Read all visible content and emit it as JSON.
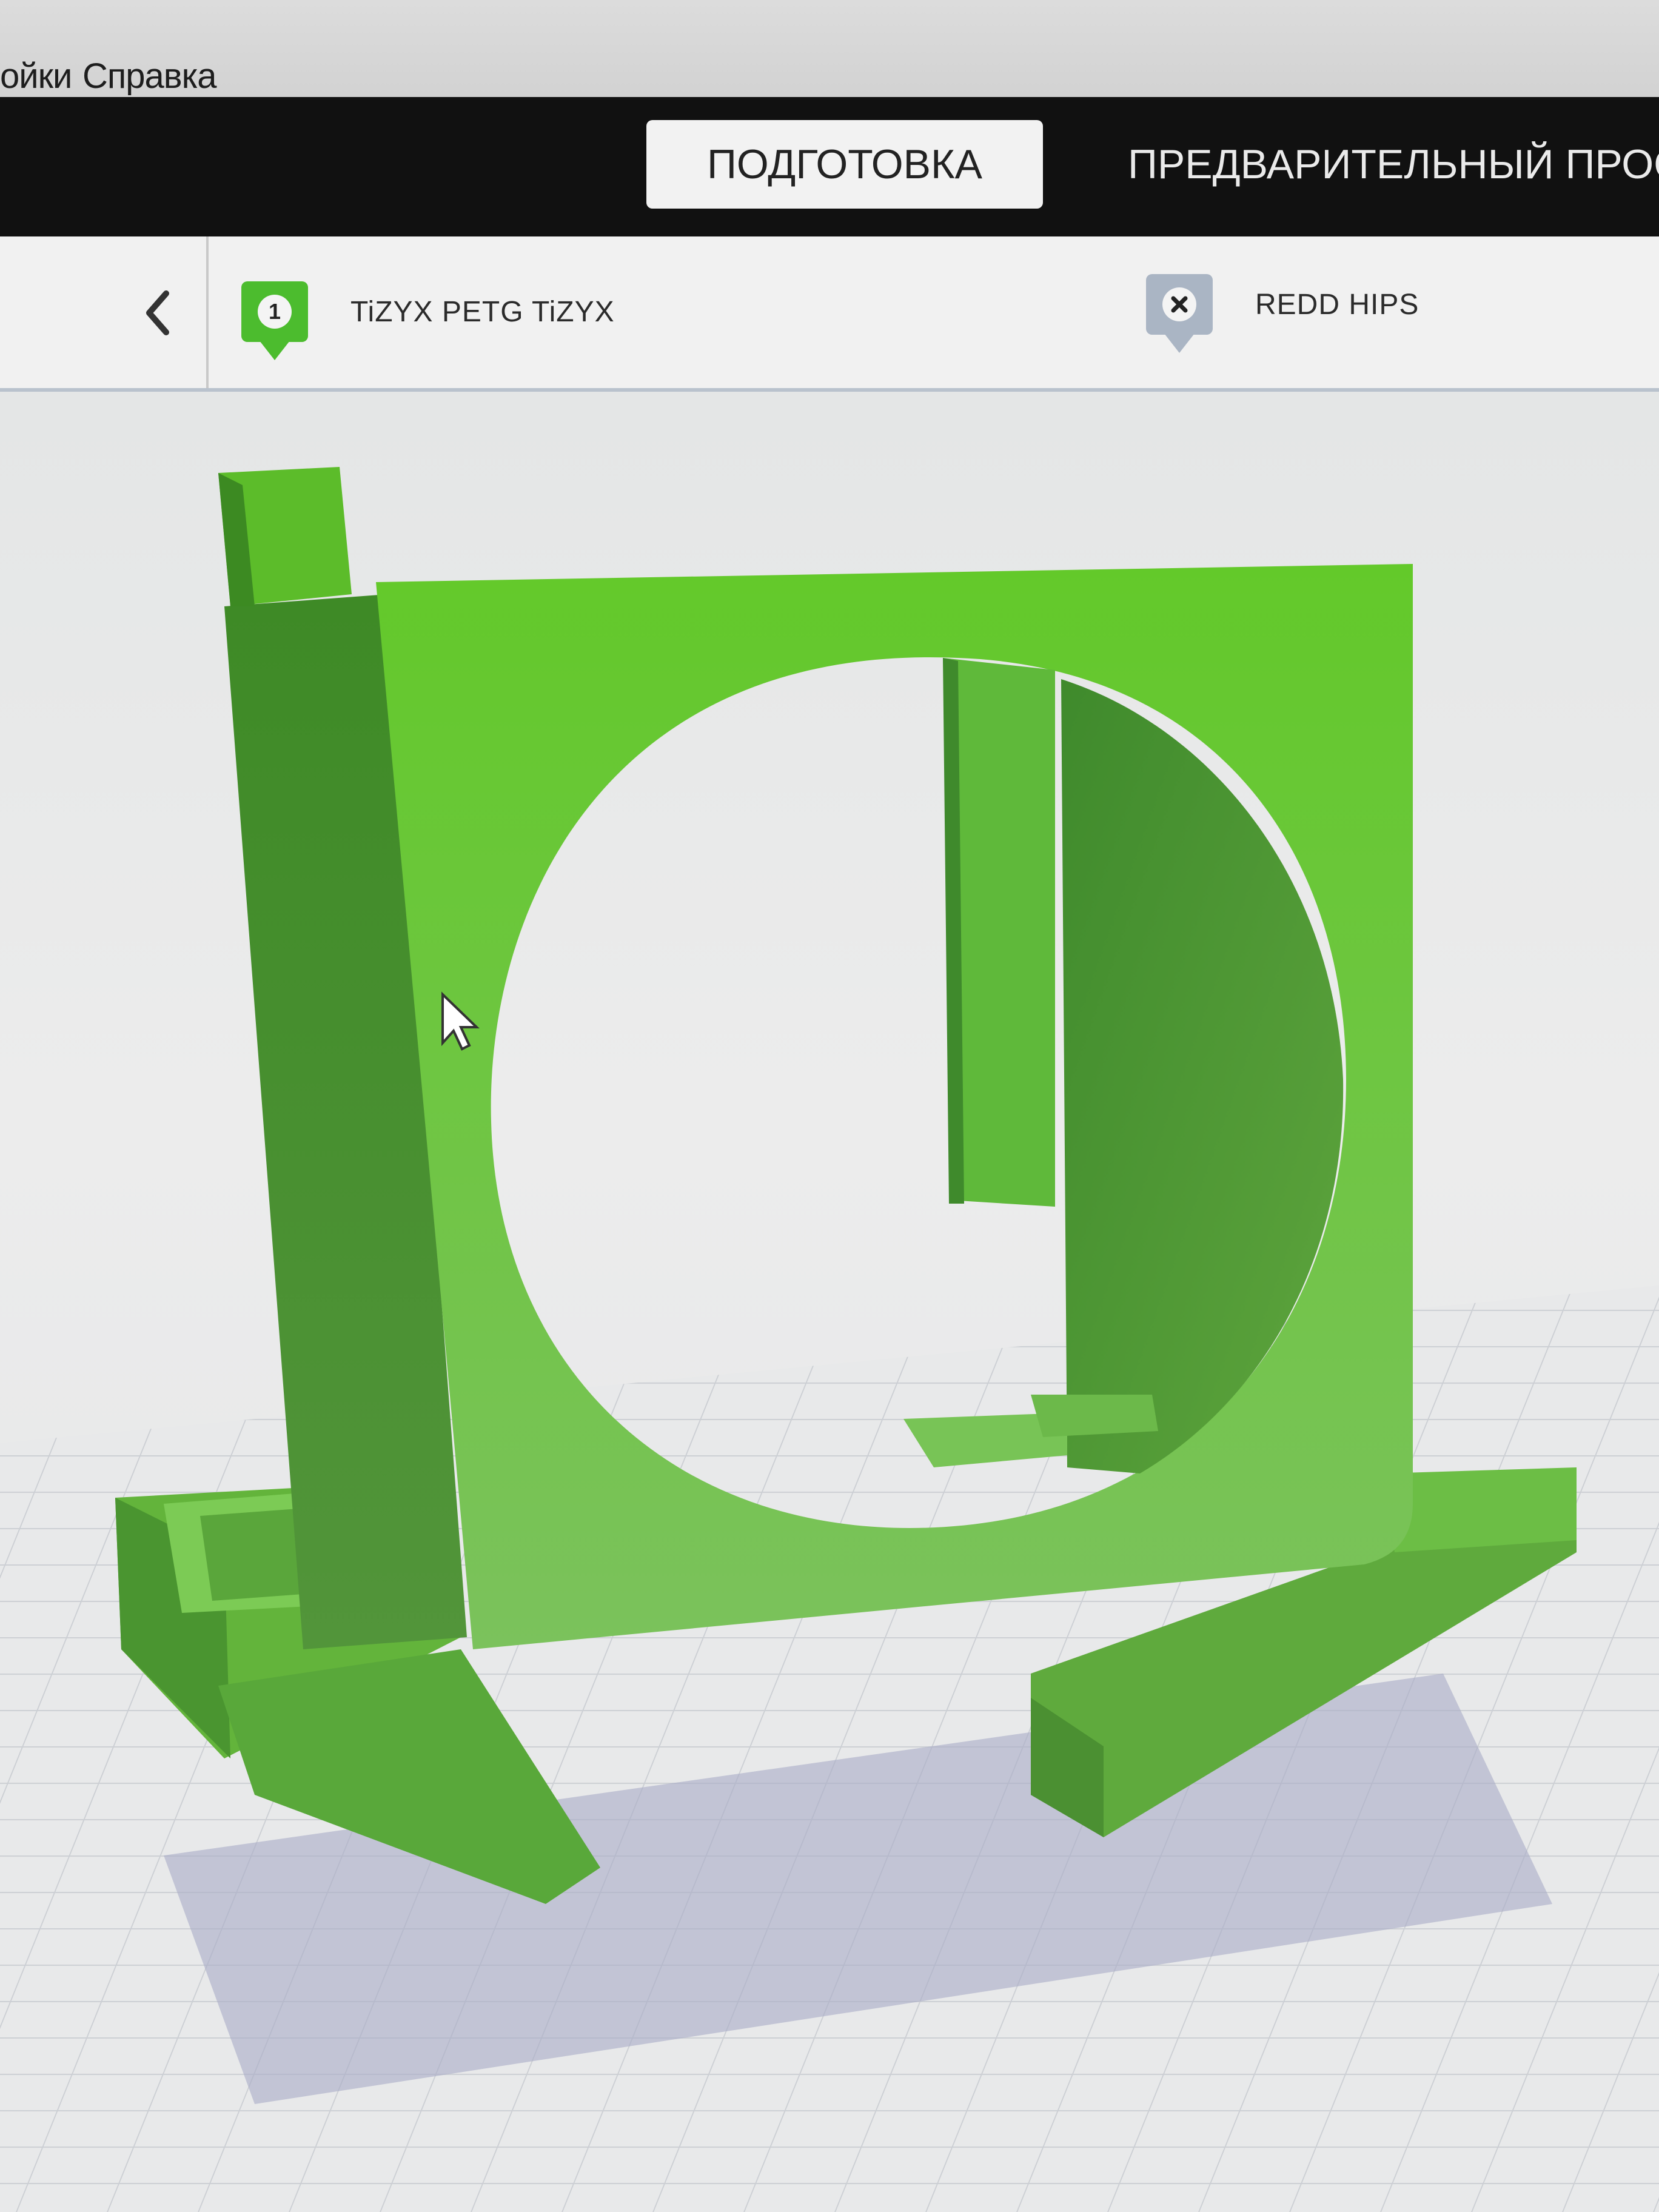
{
  "menubar": {
    "items": [
      "ойки",
      "Справка"
    ]
  },
  "stages": {
    "prepare": "ПОДГОТОВКА",
    "preview": "ПРЕДВАРИТЕЛЬНЫЙ ПРОСМ"
  },
  "extruders": [
    {
      "number": "1",
      "material": "TiZYX PETG TiZYX",
      "color": "#4cbc2e"
    },
    {
      "number": "",
      "material": "REDD HIPS",
      "color": "#aab5c4"
    }
  ],
  "icons": {
    "back": "chevron-left-icon",
    "extruder1": "extruder-badge-icon",
    "extruder2": "extruder-disabled-icon",
    "cursor": "mouse-cursor-icon"
  },
  "colors": {
    "model": "#5fc62e",
    "header": "#111111",
    "active_tab": "#f2f2f2"
  }
}
